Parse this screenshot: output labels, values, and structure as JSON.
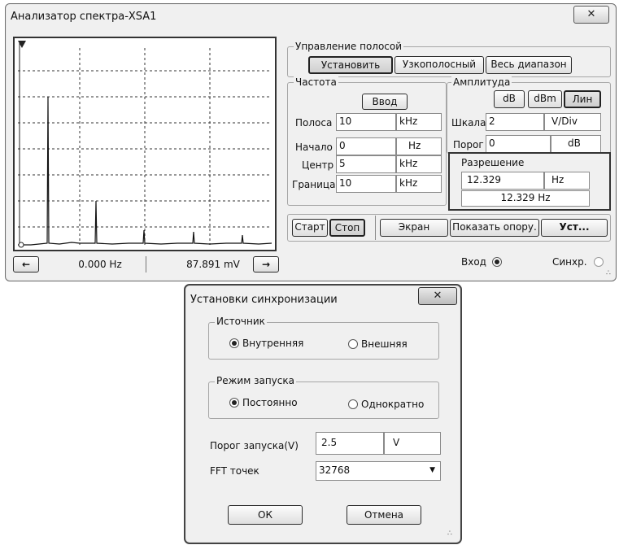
{
  "analyzer": {
    "title": "Анализатор спектра-XSA1",
    "close_glyph": "✕",
    "readout": {
      "freq": "0.000 Hz",
      "amp": "87.891 mV",
      "left_arrow": "←",
      "right_arrow": "→"
    },
    "span_control": {
      "label": "Управление полосой",
      "set_button": "Установить",
      "zero_span_button": "Узкополосный",
      "full_span_button": "Весь диапазон"
    },
    "frequency": {
      "label": "Частота",
      "enter_button": "Ввод",
      "span": {
        "label": "Полоса",
        "value": "10",
        "unit": "kHz"
      },
      "start": {
        "label": "Начало",
        "value": "0",
        "unit": "Hz"
      },
      "center": {
        "label": "Центр",
        "value": "5",
        "unit": "kHz"
      },
      "end": {
        "label": "Граница",
        "value": "10",
        "unit": "kHz"
      }
    },
    "amplitude": {
      "label": "Амплитуда",
      "db_button": "dB",
      "dbm_button": "dBm",
      "lin_button": "Лин",
      "scale": {
        "label": "Шкала",
        "value": "2",
        "unit": "V/Div"
      },
      "threshold": {
        "label": "Порог",
        "value": "0",
        "unit": "dB"
      }
    },
    "resolution": {
      "label": "Разрешение",
      "value": "12.329",
      "unit": "Hz",
      "display": "12.329 Hz"
    },
    "bottom_buttons": {
      "start": "Старт",
      "stop": "Стоп",
      "screen": "Экран",
      "show_ref": "Показать опору.",
      "settings": "Уст..."
    },
    "input_label": "Вход",
    "trigger_label": "Синхр."
  },
  "trigger_dialog": {
    "title": "Установки синхронизации",
    "close_glyph": "✕",
    "source": {
      "label": "Источник",
      "internal": "Внутренняя",
      "external": "Внешняя"
    },
    "mode": {
      "label": "Режим запуска",
      "continuous": "Постоянно",
      "single": "Однократно"
    },
    "threshold": {
      "label": "Порог запуска(V)",
      "value": "2.5",
      "unit": "V"
    },
    "fft": {
      "label": "FFT точек",
      "value": "32768"
    },
    "ok_button": "ОК",
    "cancel_button": "Отмена"
  }
}
